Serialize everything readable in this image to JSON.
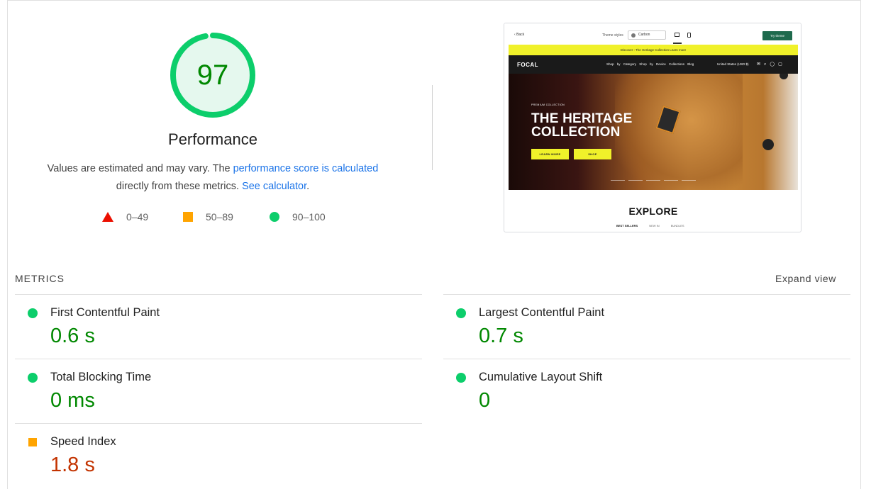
{
  "score": {
    "value": "97",
    "fraction": 0.97,
    "title": "Performance",
    "ring_color": "#0cce6b",
    "fill_color": "#e5f8ee",
    "text_color": "#008800"
  },
  "description": {
    "prefix": "Values are estimated and may vary. The ",
    "link1": "performance score is calculated",
    "middle": "directly from these metrics. ",
    "link2": "See calculator",
    "suffix": "."
  },
  "legend": [
    {
      "range": "0–49",
      "shape": "triangle",
      "color": "#eb0f00"
    },
    {
      "range": "50–89",
      "shape": "square",
      "color": "#ffa400"
    },
    {
      "range": "90–100",
      "shape": "circle",
      "color": "#0cce6b"
    }
  ],
  "thumbnail": {
    "back": "Back",
    "theme_styles_label": "Theme styles",
    "theme_select": "Carbon",
    "try_theme": "Try theme",
    "announcement": "Discover : The Heritage Collection  Learn more",
    "logo": "FOCAL",
    "nav_links": "Shop by Category   Shop by Device   Collections   Blog",
    "country": "United States (USD $)",
    "premium": "PREMIUM COLLECTION",
    "heading_line1": "THE HERITAGE",
    "heading_line2": "COLLECTION",
    "btn1": "LEARN MORE",
    "btn2": "SHOP",
    "explore": "EXPLORE",
    "tabs": [
      "BEST SELLERS",
      "NEW IN",
      "BUNDLES"
    ]
  },
  "metrics_header": "METRICS",
  "expand_view": "Expand view",
  "metrics": [
    {
      "name": "First Contentful Paint",
      "value": "0.6 s",
      "rating": "good"
    },
    {
      "name": "Largest Contentful Paint",
      "value": "0.7 s",
      "rating": "good"
    },
    {
      "name": "Total Blocking Time",
      "value": "0 ms",
      "rating": "good"
    },
    {
      "name": "Cumulative Layout Shift",
      "value": "0",
      "rating": "good"
    },
    {
      "name": "Speed Index",
      "value": "1.8 s",
      "rating": "average"
    }
  ]
}
